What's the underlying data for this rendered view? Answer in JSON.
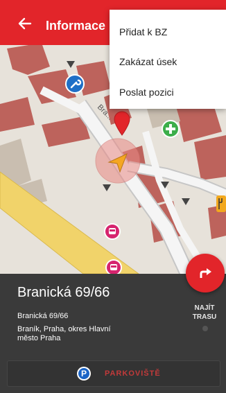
{
  "app_bar": {
    "title": "Informace",
    "back_icon": "arrow-left-icon",
    "color": "#e2252a"
  },
  "overflow_menu": {
    "items": [
      "Přidat k BZ",
      "Zakázat úsek",
      "Poslat pozici"
    ]
  },
  "map": {
    "street_label": "Bra...",
    "icons": [
      "wrench-icon",
      "plus-cross-icon",
      "bus-stop-icon",
      "bus-stop-icon",
      "restaurant-icon",
      "location-pin-icon",
      "navigation-arrow-icon"
    ]
  },
  "place": {
    "name": "Branická 69/66",
    "address_line1": "Branická 69/66",
    "address_line2": "Braník, Praha, okres Hlavní město Praha"
  },
  "route_button": {
    "label": "NAJÍT TRASU",
    "icon": "turn-right-arrow-icon"
  },
  "parking_button": {
    "label": "PARKOVIŠTĚ",
    "icon_text": "P",
    "icon": "parking-icon"
  }
}
